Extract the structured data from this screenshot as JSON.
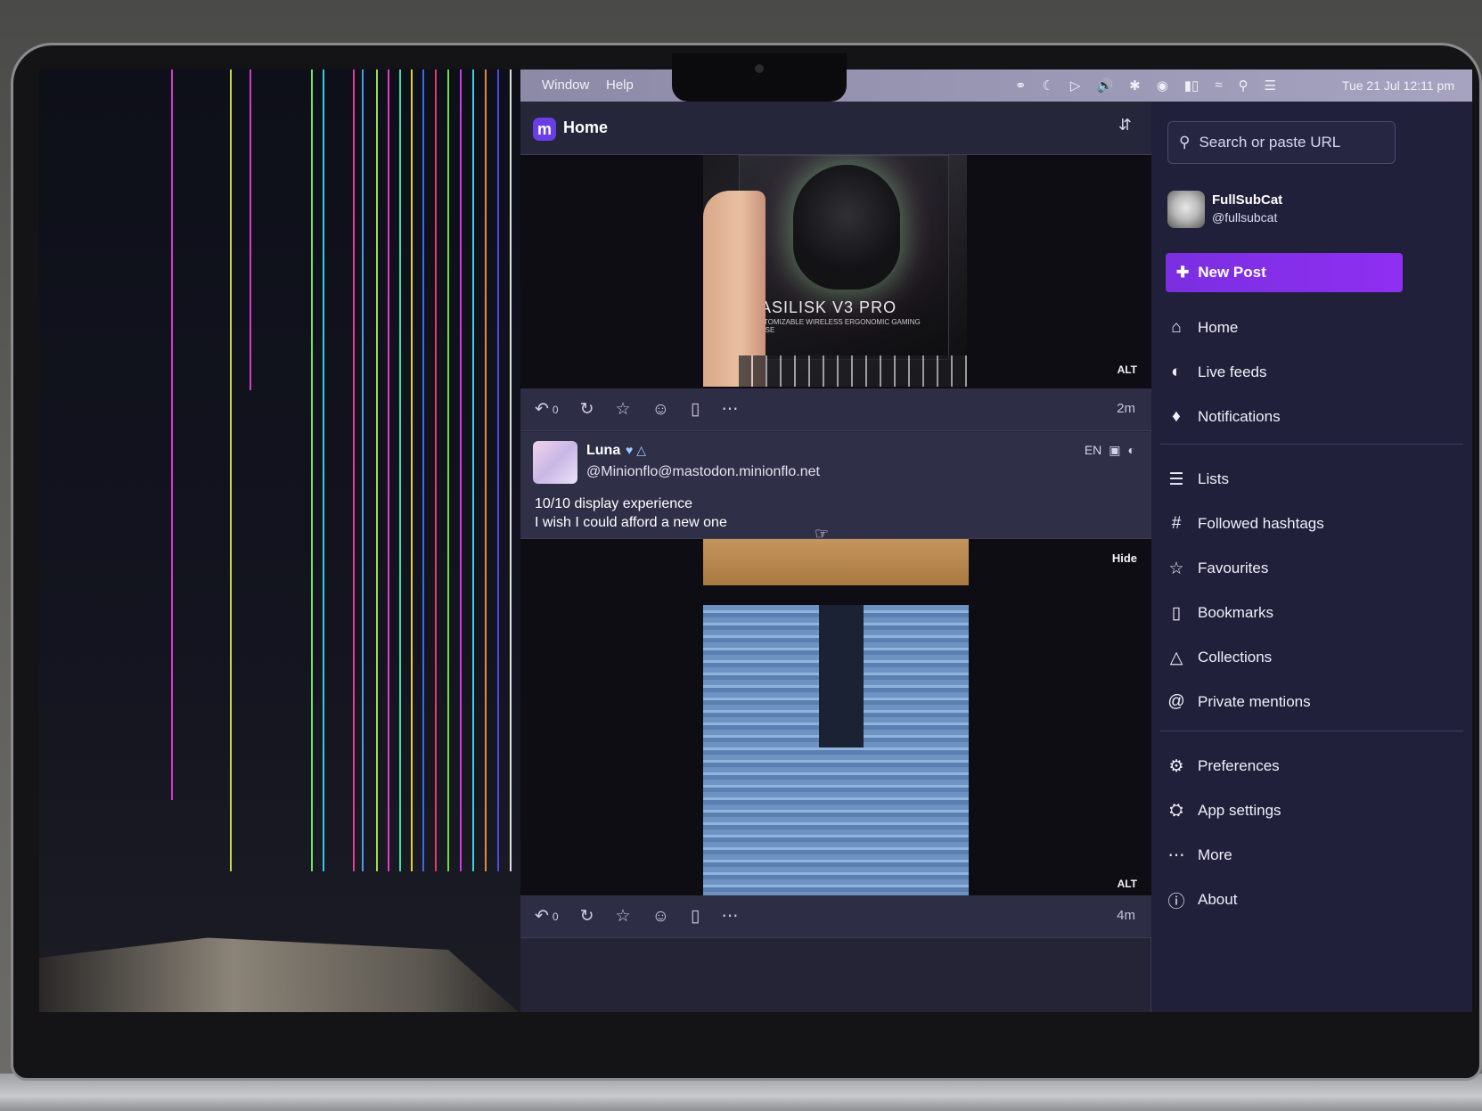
{
  "menubar": {
    "items": [
      "Window",
      "Help"
    ],
    "status_icons": [
      "user-icon",
      "moon-icon",
      "play-icon",
      "volume-icon",
      "bluetooth-icon",
      "profile-icon",
      "battery-icon",
      "wifi-icon",
      "search-icon",
      "control-center-icon"
    ],
    "clock": "Tue 21 Jul  12:11 pm"
  },
  "column": {
    "title": "Home",
    "logo": "m"
  },
  "first_post": {
    "media_brand": "BASILISK V3 PRO",
    "media_sub": "CUSTOMIZABLE WIRELESS ERGONOMIC GAMING MOUSE",
    "alt_label": "ALT",
    "reply_count": "0",
    "time": "2m"
  },
  "second_post": {
    "name": "Luna",
    "handle": "@Minionflo@mastodon.minionflo.net",
    "language": "EN",
    "text_line1": "10/10 display experience",
    "text_line2": "I wish I could afford a new one",
    "hide_label": "Hide",
    "alt_label": "ALT",
    "reply_count": "0",
    "time": "4m"
  },
  "sidebar": {
    "search_placeholder": "Search or paste URL",
    "account": {
      "name": "FullSubCat",
      "handle": "@fullsubcat"
    },
    "new_post": "New Post",
    "nav": [
      {
        "label": "Home",
        "icon": "home-icon"
      },
      {
        "label": "Live feeds",
        "icon": "globe-icon"
      },
      {
        "label": "Notifications",
        "icon": "bell-icon"
      },
      {
        "label": "Lists",
        "icon": "list-icon"
      },
      {
        "label": "Followed hashtags",
        "icon": "hashtag-icon"
      },
      {
        "label": "Favourites",
        "icon": "star-icon"
      },
      {
        "label": "Bookmarks",
        "icon": "bookmark-icon"
      },
      {
        "label": "Collections",
        "icon": "collections-icon"
      },
      {
        "label": "Private mentions",
        "icon": "at-icon"
      },
      {
        "label": "Preferences",
        "icon": "gear-icon"
      },
      {
        "label": "App settings",
        "icon": "settings-icon"
      },
      {
        "label": "More",
        "icon": "ellipsis-icon"
      },
      {
        "label": "About",
        "icon": "info-icon"
      }
    ]
  },
  "colors": {
    "accent": "#8f2ff2",
    "column_bg": "#242436",
    "sidebar_bg": "#20203a"
  }
}
